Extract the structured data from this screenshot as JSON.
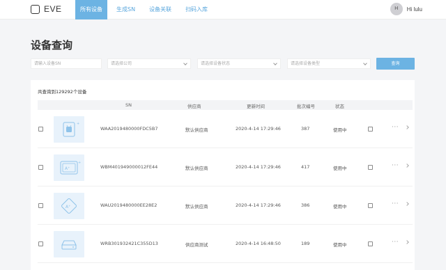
{
  "app": {
    "name": "EVE"
  },
  "nav": {
    "items": [
      {
        "label": "所有设备",
        "active": true
      },
      {
        "label": "生成SN",
        "active": false
      },
      {
        "label": "设备关联",
        "active": false
      },
      {
        "label": "扫码入库",
        "active": false
      }
    ]
  },
  "user": {
    "initials": "H",
    "greeting": "Hi lulu"
  },
  "page": {
    "title": "设备查询"
  },
  "filters": {
    "sn_placeholder": "请输入设备SN",
    "company_placeholder": "请选择公司",
    "status_placeholder": "请选择设备状态",
    "type_placeholder": "请选择设备类型",
    "search_label": "查询"
  },
  "summary": {
    "total_text": "共查询到129292个设备"
  },
  "table": {
    "headers": {
      "sn": "SN",
      "vendor": "供应商",
      "updated": "更新时间",
      "batch": "批次编号",
      "status": "状态"
    },
    "rows": [
      {
        "icon": "android-device-icon",
        "sn": "WAA2019480000FDC5B7",
        "vendor": "默认供应商",
        "updated": "2020-4-14 17:29:46",
        "batch": "387",
        "status": "使用中",
        "more": "···"
      },
      {
        "icon": "tablet-device-icon",
        "sn": "WBM401949000012FE44",
        "vendor": "默认供应商",
        "updated": "2020-4-14 17:29:46",
        "batch": "417",
        "status": "使用中",
        "more": "···"
      },
      {
        "icon": "chip-device-icon",
        "sn": "WAU2019480000EE28E2",
        "vendor": "默认供应商",
        "updated": "2020-4-14 17:29:46",
        "batch": "386",
        "status": "使用中",
        "more": "···"
      },
      {
        "icon": "router-device-icon",
        "sn": "WRB301932421C355D13",
        "vendor": "供应商测试",
        "updated": "2020-4-14 16:48:50",
        "batch": "189",
        "status": "使用中",
        "more": "···"
      }
    ]
  },
  "colors": {
    "accent": "#6cb3e3",
    "thumb_bg": "#e8f2fb",
    "icon_stroke": "#8fc3ea"
  }
}
